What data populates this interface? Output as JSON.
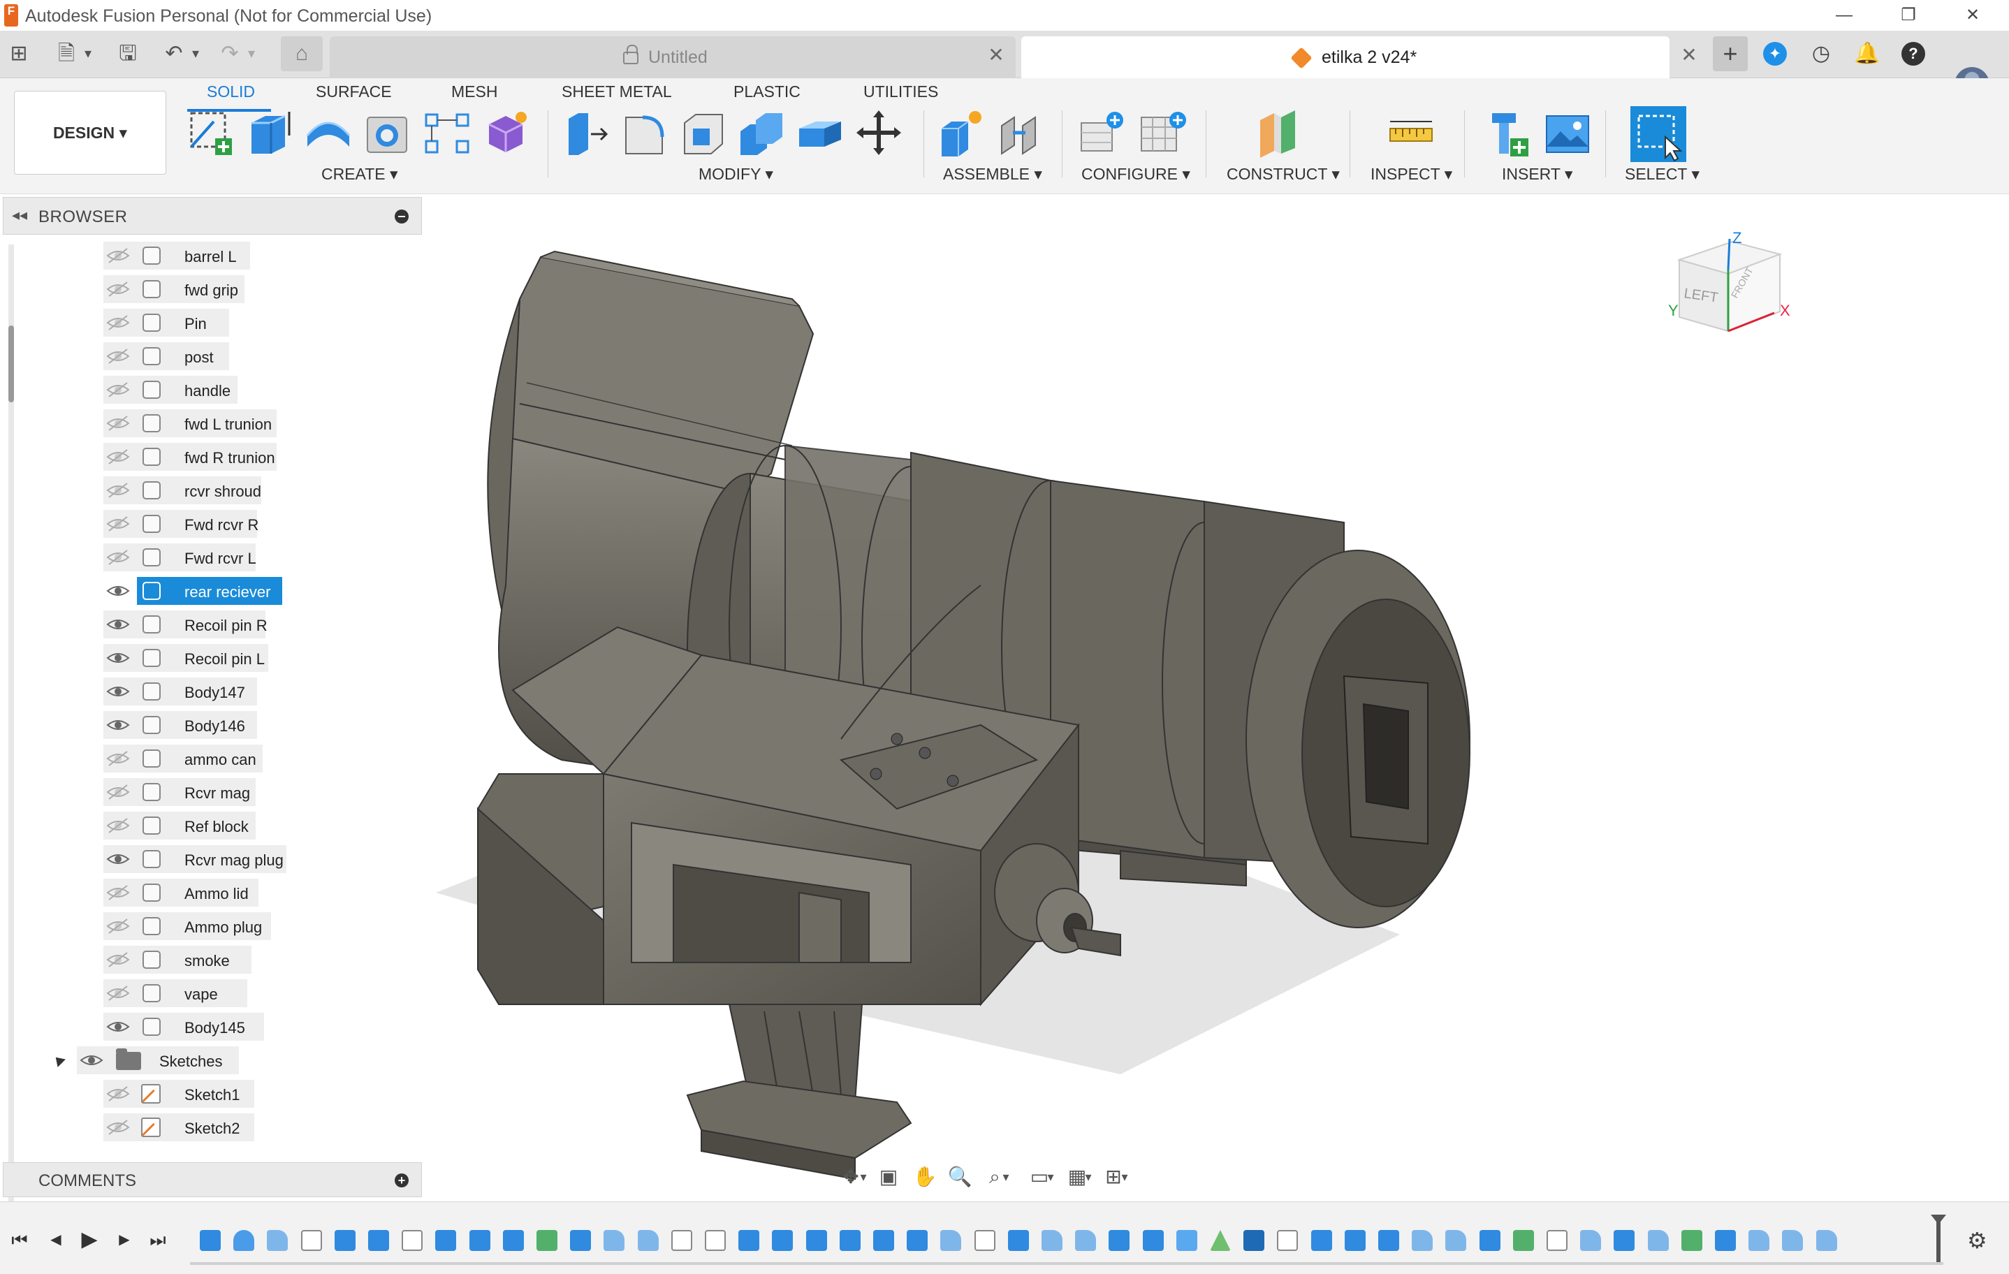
{
  "window": {
    "title": "Autodesk Fusion Personal (Not for Commercial Use)",
    "logo_letter": "F",
    "minimize": "—",
    "restore": "❐",
    "close": "✕"
  },
  "tabs": {
    "untitled_label": "Untitled",
    "active_label": "etilka 2 v24*",
    "close_glyph": "✕",
    "new_tab_glyph": "+"
  },
  "quick_access": {
    "grid": "⊞",
    "file": "🗎",
    "save": "🖫",
    "undo": "↶",
    "redo": "↷",
    "home": "⌂",
    "caret": "▾"
  },
  "right_icons": {
    "extensions": "✦",
    "history": "◷",
    "notifications": "🔔",
    "help": "?"
  },
  "toolbar": {
    "design_label": "DESIGN ▾",
    "workspace_tabs": [
      "SOLID",
      "SURFACE",
      "MESH",
      "SHEET METAL",
      "PLASTIC",
      "UTILITIES"
    ],
    "groups": [
      "CREATE ▾",
      "MODIFY ▾",
      "ASSEMBLE ▾",
      "CONFIGURE ▾",
      "CONSTRUCT ▾",
      "INSPECT ▾",
      "INSERT ▾",
      "SELECT ▾"
    ]
  },
  "browser": {
    "title": "BROWSER",
    "collapse_glyph": "◂◂",
    "bodies": [
      {
        "label": "barrel L",
        "visible": false
      },
      {
        "label": "fwd grip",
        "visible": false
      },
      {
        "label": "Pin",
        "visible": false
      },
      {
        "label": "post",
        "visible": false
      },
      {
        "label": "handle",
        "visible": false
      },
      {
        "label": "fwd L trunion",
        "visible": false
      },
      {
        "label": "fwd R trunion",
        "visible": false
      },
      {
        "label": "rcvr shroud",
        "visible": false
      },
      {
        "label": "Fwd rcvr R",
        "visible": false
      },
      {
        "label": "Fwd rcvr L",
        "visible": false
      },
      {
        "label": "rear reciever",
        "visible": true,
        "selected": true
      },
      {
        "label": "Recoil pin R",
        "visible": true
      },
      {
        "label": "Recoil pin L",
        "visible": true
      },
      {
        "label": "Body147",
        "visible": true
      },
      {
        "label": "Body146",
        "visible": true
      },
      {
        "label": "ammo can",
        "visible": false
      },
      {
        "label": "Rcvr mag",
        "visible": false
      },
      {
        "label": "Ref block",
        "visible": false
      },
      {
        "label": "Rcvr mag plug",
        "visible": true
      },
      {
        "label": "Ammo lid",
        "visible": false
      },
      {
        "label": "Ammo plug",
        "visible": false
      },
      {
        "label": "smoke",
        "visible": false
      },
      {
        "label": "vape",
        "visible": false
      },
      {
        "label": "Body145",
        "visible": true
      }
    ],
    "sketches_folder": "Sketches",
    "sketches": [
      {
        "label": "Sketch1",
        "visible": false
      },
      {
        "label": "Sketch2",
        "visible": false
      }
    ]
  },
  "comments": {
    "title": "COMMENTS",
    "add_glyph": "+"
  },
  "viewcube": {
    "left": "LEFT",
    "front": "FRONT",
    "axis_x": "X",
    "axis_y": "Y",
    "axis_z": "Z"
  },
  "nav_bar": {
    "orbit": "✥",
    "look": "▣",
    "pan": "✋",
    "zoom": "🔍",
    "fit": "⌕",
    "display": "▭",
    "grid": "▦",
    "viewports": "⊞",
    "caret": "▾"
  },
  "timeline": {
    "first": "⏮",
    "prev": "◀",
    "play": "▶",
    "next": "▶",
    "last": "⏭",
    "settings": "⚙",
    "features": [
      "extrude",
      "revolve",
      "fillet",
      "sketch",
      "extrude",
      "extrude",
      "sketch",
      "extrude",
      "extrude",
      "extrude",
      "split",
      "extrude",
      "fillet",
      "fillet",
      "sketch",
      "sketch",
      "extrude",
      "extrude",
      "extrude",
      "extrude",
      "extrude",
      "extrude",
      "fillet",
      "sketch",
      "extrude",
      "fillet",
      "fillet",
      "extrude",
      "extrude",
      "chamfer",
      "plane",
      "move",
      "sketch",
      "extrude",
      "extrude",
      "extrude",
      "fillet",
      "fillet",
      "extrude",
      "split",
      "sketch",
      "fillet",
      "extrude",
      "fillet",
      "split",
      "extrude",
      "fillet",
      "fillet",
      "fillet"
    ]
  },
  "colors": {
    "accent": "#1a7cd9",
    "selection": "#1a8bd8",
    "model_body": "#6e6b63",
    "model_dark": "#4e4b45",
    "model_light": "#8a877e"
  }
}
